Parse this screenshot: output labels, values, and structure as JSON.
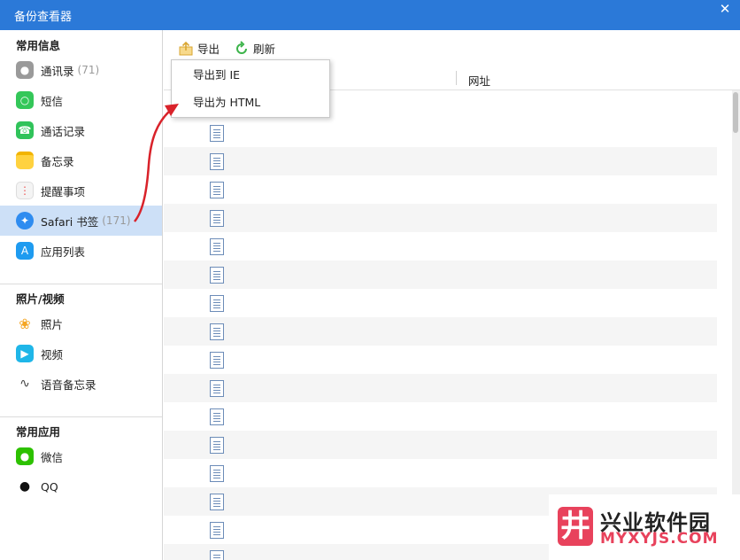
{
  "window": {
    "title": "备份查看器",
    "close_glyph": "✕"
  },
  "sidebar": {
    "groups": [
      {
        "title": "常用信息"
      },
      {
        "title": "照片/视频"
      },
      {
        "title": "常用应用"
      }
    ],
    "items": [
      {
        "label": "通讯录",
        "count": "(71)",
        "icon": "contacts-icon"
      },
      {
        "label": "短信",
        "count": "",
        "icon": "messages-icon"
      },
      {
        "label": "通话记录",
        "count": "",
        "icon": "phone-icon"
      },
      {
        "label": "备忘录",
        "count": "",
        "icon": "notes-icon"
      },
      {
        "label": "提醒事项",
        "count": "",
        "icon": "reminders-icon"
      },
      {
        "label": "Safari 书签",
        "count": "(171)",
        "icon": "safari-icon",
        "active": true
      },
      {
        "label": "应用列表",
        "count": "",
        "icon": "appstore-icon"
      },
      {
        "label": "照片",
        "count": "",
        "icon": "photos-icon"
      },
      {
        "label": "视频",
        "count": "",
        "icon": "video-icon"
      },
      {
        "label": "语音备忘录",
        "count": "",
        "icon": "voice-memo-icon"
      },
      {
        "label": "微信",
        "count": "",
        "icon": "wechat-icon"
      },
      {
        "label": "QQ",
        "count": "",
        "icon": "qq-icon"
      }
    ]
  },
  "toolbar": {
    "export_label": "导出",
    "refresh_label": "刷新"
  },
  "export_menu": {
    "items": [
      "导出到 IE",
      "导出为 HTML"
    ]
  },
  "table": {
    "url_header": "网址"
  },
  "watermark": {
    "brand_cn": "兴业软件园",
    "brand_en": "MYXYJS.COM",
    "logo_glyph": "井"
  },
  "colors": {
    "titlebar": "#2b79d8",
    "active_item": "#cde0f7",
    "arrow": "#d9222a",
    "watermark_accent": "#e8425c"
  }
}
